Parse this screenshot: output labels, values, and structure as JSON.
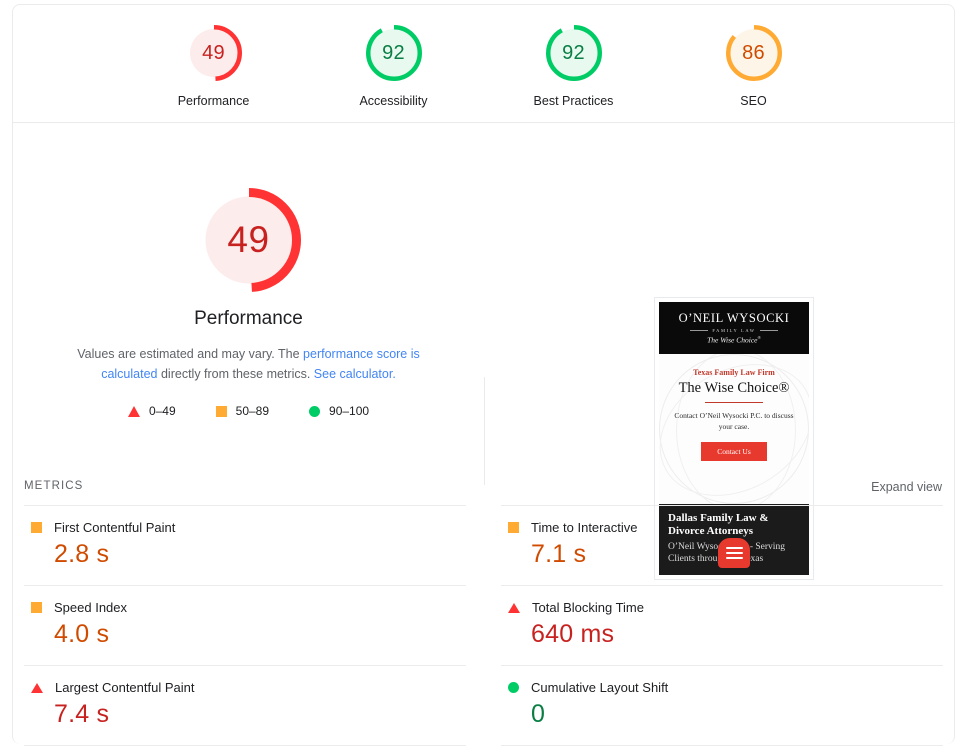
{
  "colors": {
    "red": "#f33",
    "orange": "#fa3",
    "green": "#0c6",
    "red_fill": "#fdecec",
    "orange_fill": "#fdf6e8",
    "green_fill": "#e8faf0",
    "value_red": "#c7221f",
    "value_orange": "#d04b00",
    "value_green": "#0a7e44",
    "link_blue": "#4285f4"
  },
  "gauges": [
    {
      "score": "49",
      "label": "Performance",
      "pct": 49,
      "tone": "red"
    },
    {
      "score": "92",
      "label": "Accessibility",
      "pct": 92,
      "tone": "green"
    },
    {
      "score": "92",
      "label": "Best Practices",
      "pct": 92,
      "tone": "green"
    },
    {
      "score": "86",
      "label": "SEO",
      "pct": 86,
      "tone": "orange"
    }
  ],
  "hero": {
    "score": "49",
    "title": "Performance",
    "desc_part1": "Values are estimated and may vary. The ",
    "link1": "performance score is calculated",
    "desc_part2": " directly from these metrics. ",
    "link2": "See calculator.",
    "legend": [
      {
        "icon": "triangle",
        "range": "0–49"
      },
      {
        "icon": "square",
        "range": "50–89"
      },
      {
        "icon": "circle",
        "range": "90–100"
      }
    ]
  },
  "thumbnail": {
    "logo": "O’NEIL WYSOCKI",
    "logo_sub": "FAMILY LAW",
    "tagline": "The Wise Choice",
    "tagline_sup": "®",
    "eyebrow": "Texas Family Law Firm",
    "headline": "The Wise Choice®",
    "subtext": "Contact O’Neil Wysocki P.C. to discuss your case.",
    "cta": "Contact Us",
    "footer_title": "Dallas Family Law & Divorce Attorneys",
    "footer_body": "O’Neil Wysocki P.C. - Serving Clients throughout Texas",
    "fab": "hamburger-menu"
  },
  "metrics": {
    "section_label": "METRICS",
    "expand_label": "Expand view",
    "left": [
      {
        "icon": "square",
        "name": "First Contentful Paint",
        "value": "2.8 s",
        "tone": "orange"
      },
      {
        "icon": "square",
        "name": "Speed Index",
        "value": "4.0 s",
        "tone": "orange"
      },
      {
        "icon": "triangle",
        "name": "Largest Contentful Paint",
        "value": "7.4 s",
        "tone": "red"
      }
    ],
    "right": [
      {
        "icon": "square",
        "name": "Time to Interactive",
        "value": "7.1 s",
        "tone": "orange"
      },
      {
        "icon": "triangle",
        "name": "Total Blocking Time",
        "value": "640 ms",
        "tone": "red"
      },
      {
        "icon": "circle",
        "name": "Cumulative Layout Shift",
        "value": "0",
        "tone": "green"
      }
    ]
  }
}
